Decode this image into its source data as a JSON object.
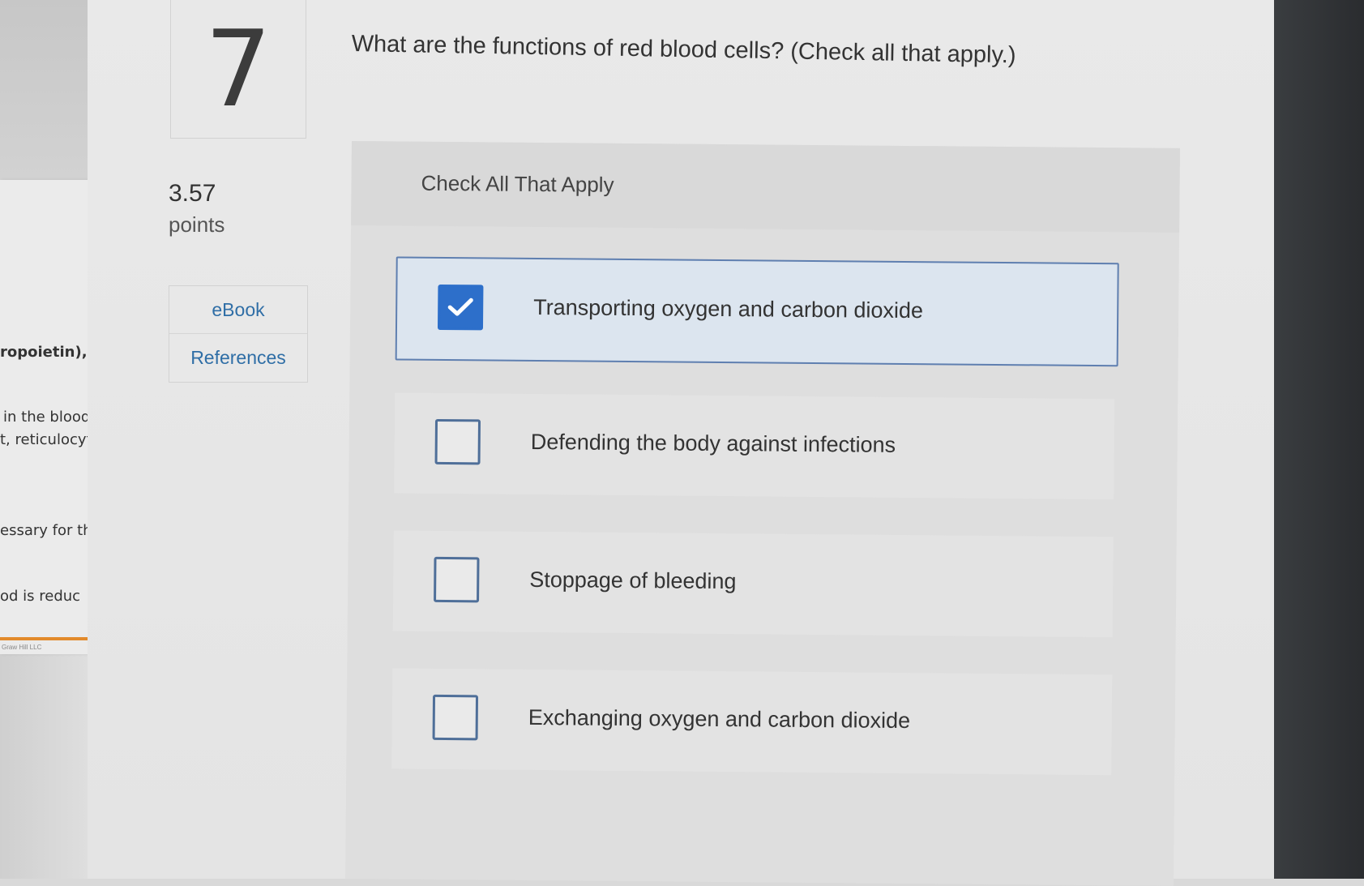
{
  "question": {
    "number": "7",
    "text": "What are the functions of red blood cells? (Check all that apply.)",
    "points_value": "3.57",
    "points_label": "points"
  },
  "resources": {
    "ebook_label": "eBook",
    "references_label": "References"
  },
  "answer_panel": {
    "header": "Check All That Apply",
    "options": [
      {
        "label": "Transporting oxygen and carbon dioxide",
        "checked": true
      },
      {
        "label": "Defending the body against infections",
        "checked": false
      },
      {
        "label": "Stoppage of bleeding",
        "checked": false
      },
      {
        "label": "Exchanging oxygen and carbon dioxide",
        "checked": false
      }
    ]
  },
  "book_fragments": {
    "line1": "ropoietin),",
    "line2": "in the blood",
    "line3": "t, reticulocyte",
    "line4": "essary for th",
    "line5": "od is reduc",
    "footer": "Graw Hill LLC"
  },
  "colors": {
    "checked_fill": "#2d6fca",
    "link_blue": "#2f6ea6",
    "selected_border": "#5f7fb0"
  }
}
